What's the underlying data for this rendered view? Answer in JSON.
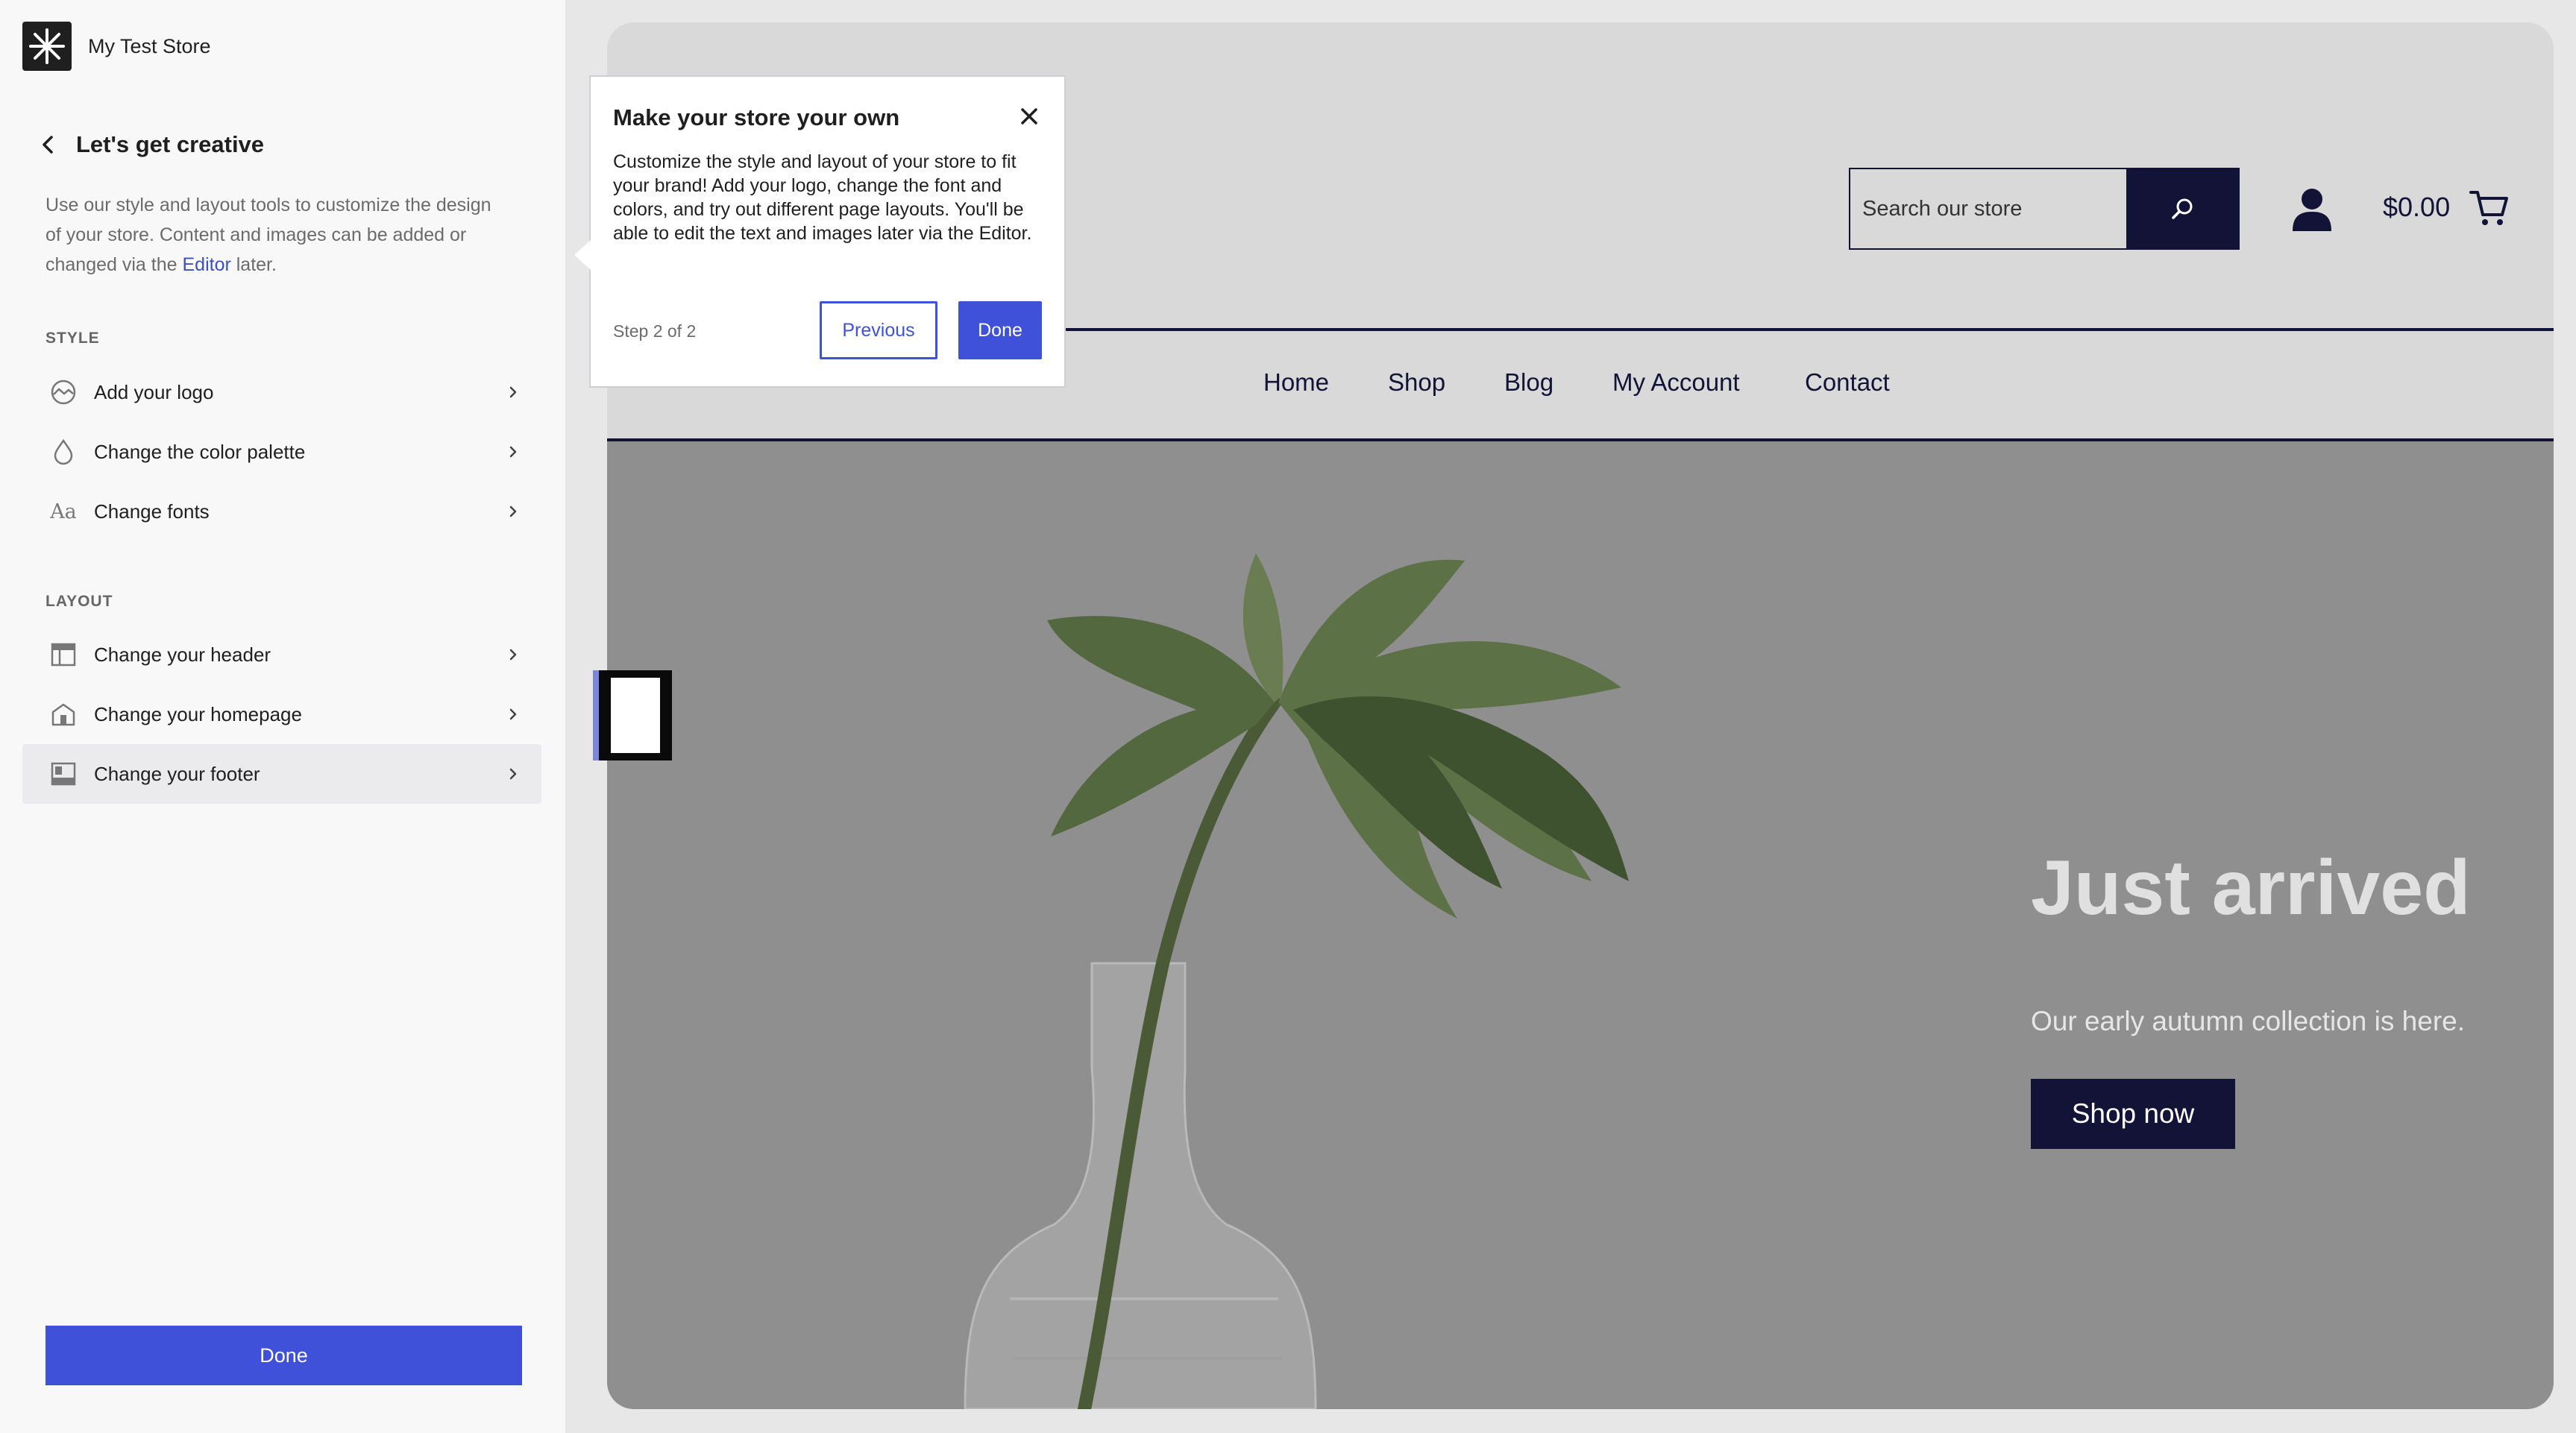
{
  "app": {
    "store_name": "My Test Store"
  },
  "sidebar": {
    "title": "Let's get creative",
    "intro_before": "Use our style and layout tools to customize the design of your store. Content and images can be added or changed via the ",
    "intro_link": "Editor",
    "intro_after": " later.",
    "style_label": "STYLE",
    "layout_label": "LAYOUT",
    "style_items": [
      {
        "label": "Add your logo",
        "icon": "logo-icon"
      },
      {
        "label": "Change the color palette",
        "icon": "droplet-icon"
      },
      {
        "label": "Change fonts",
        "icon": "font-icon",
        "glyph": "Aa"
      }
    ],
    "layout_items": [
      {
        "label": "Change your header",
        "icon": "header-layout-icon"
      },
      {
        "label": "Change your homepage",
        "icon": "homepage-icon"
      },
      {
        "label": "Change your footer",
        "icon": "footer-layout-icon",
        "active": true
      }
    ],
    "done_label": "Done"
  },
  "preview": {
    "search_placeholder": "Search our store",
    "cart_total": "$0.00",
    "nav": [
      "Home",
      "Shop",
      "Blog",
      "My Account",
      "Contact"
    ],
    "hero": {
      "title": "Just arrived",
      "subtitle": "Our early autumn collection is here.",
      "cta": "Shop now"
    }
  },
  "tour": {
    "title": "Make your store your own",
    "body": "Customize the style and layout of your store to fit your brand! Add your logo, change the font and colors, and try out different page layouts. You'll be able to edit the text and images later via the Editor.",
    "step": "Step 2 of 2",
    "previous_label": "Previous",
    "done_label": "Done"
  },
  "colors": {
    "accent": "#3f51d8",
    "navy": "#121337",
    "sidebar_bg": "#f8f8f9",
    "preview_bg": "#d9d9d9",
    "hero_bg": "#8f8f8f"
  }
}
